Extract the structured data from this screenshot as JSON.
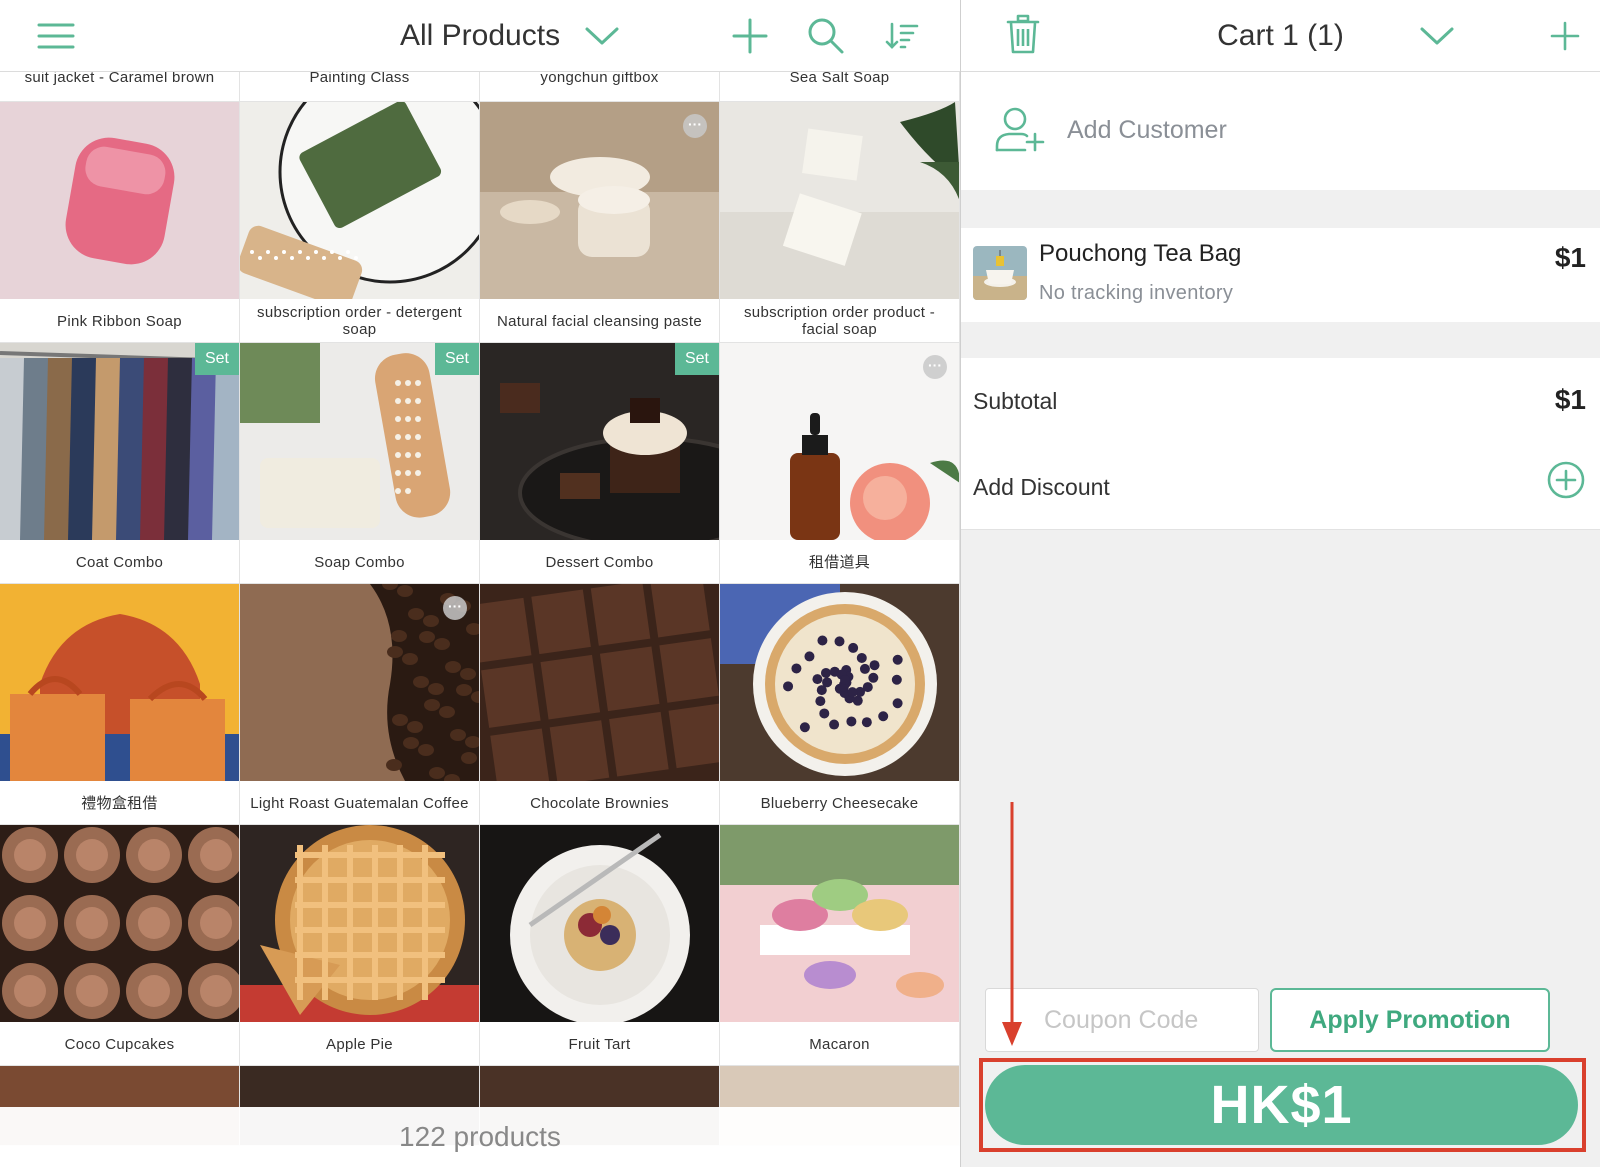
{
  "products_panel": {
    "title": "All Products",
    "top_row_labels": [
      "suit jacket - Caramel brown",
      "Painting Class",
      "yongchun giftbox",
      "Sea Salt Soap"
    ],
    "items": [
      {
        "name": "Pink Ribbon Soap",
        "badge": "",
        "more": false,
        "image": "pink-soap"
      },
      {
        "name": "subscription order - detergent soap",
        "badge": "",
        "more": false,
        "image": "green-soap"
      },
      {
        "name": "Natural facial cleansing paste",
        "badge": "",
        "more": true,
        "image": "cream-jar"
      },
      {
        "name": "subscription order product - facial soap",
        "badge": "",
        "more": false,
        "image": "white-soap"
      },
      {
        "name": "Coat Combo",
        "badge": "Set",
        "more": false,
        "image": "coats"
      },
      {
        "name": "Soap Combo",
        "badge": "Set",
        "more": false,
        "image": "soap-brush"
      },
      {
        "name": "Dessert Combo",
        "badge": "Set",
        "more": false,
        "image": "dessert"
      },
      {
        "name": "租借道具",
        "badge": "",
        "more": true,
        "image": "bottle-rose"
      },
      {
        "name": "禮物盒租借",
        "badge": "",
        "more": false,
        "image": "giftbox"
      },
      {
        "name": "Light Roast Guatemalan Coffee",
        "badge": "",
        "more": true,
        "image": "coffee"
      },
      {
        "name": "Chocolate Brownies",
        "badge": "",
        "more": false,
        "image": "brownies"
      },
      {
        "name": "Blueberry Cheesecake",
        "badge": "",
        "more": false,
        "image": "cheesecake"
      },
      {
        "name": "Coco Cupcakes",
        "badge": "",
        "more": false,
        "image": "cupcakes"
      },
      {
        "name": "Apple Pie",
        "badge": "",
        "more": false,
        "image": "apple-pie"
      },
      {
        "name": "Fruit Tart",
        "badge": "",
        "more": false,
        "image": "fruit-tart"
      },
      {
        "name": "Macaron",
        "badge": "",
        "more": false,
        "image": "macaron"
      }
    ],
    "product_count": "122 products"
  },
  "cart_panel": {
    "title": "Cart 1 (1)",
    "add_customer": "Add Customer",
    "line_item": {
      "name": "Pouchong Tea Bag",
      "subtitle": "No tracking inventory",
      "price": "$1"
    },
    "subtotal_label": "Subtotal",
    "subtotal_value": "$1",
    "add_discount": "Add Discount",
    "coupon_placeholder": "Coupon Code",
    "apply_promotion": "Apply Promotion",
    "checkout_total": "HK$1"
  },
  "colors": {
    "accent": "#5cb896",
    "highlight": "#d9402d"
  }
}
